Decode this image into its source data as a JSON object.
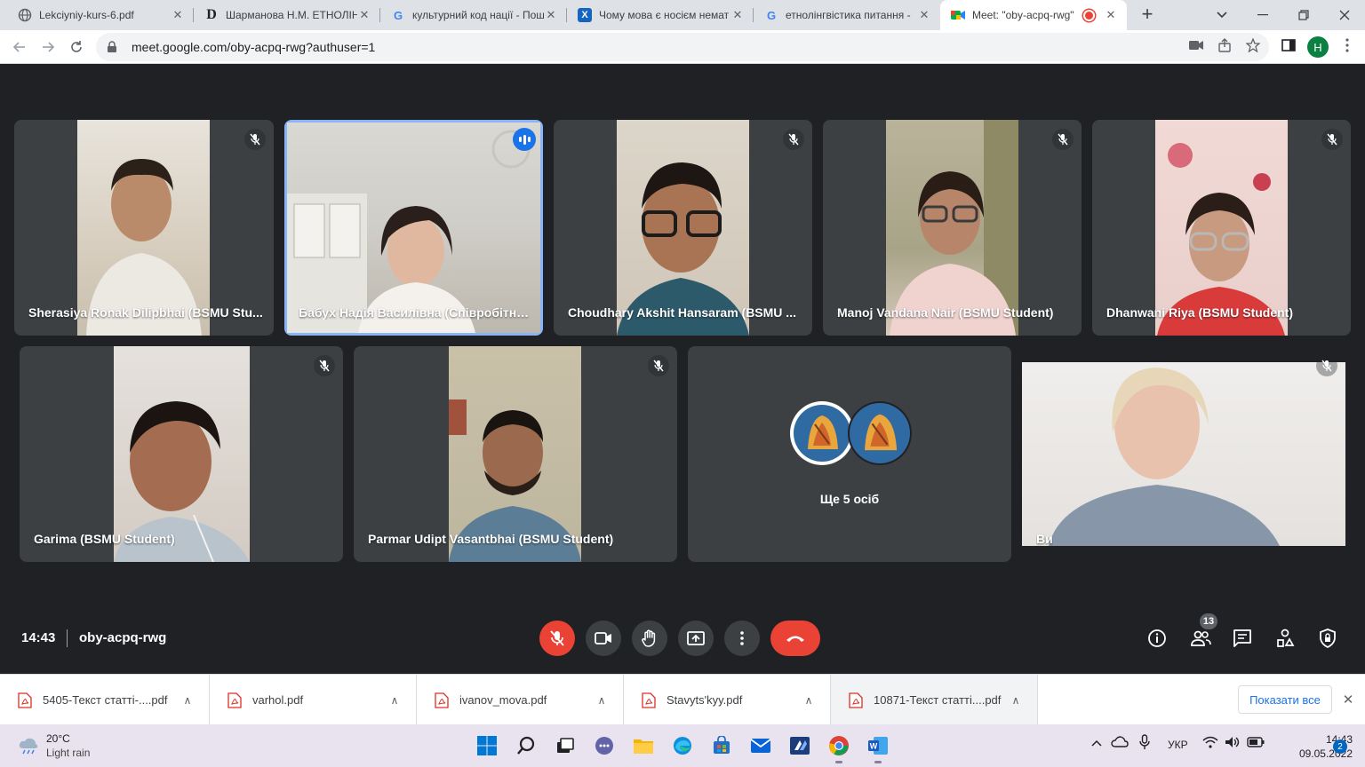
{
  "browser": {
    "tabs": [
      {
        "title": "Lekciyniy-kurs-6.pdf",
        "icon": "globe-icon"
      },
      {
        "title": "Шарманова Н.М. ЕТНОЛІНГ",
        "icon": "d-letter-icon"
      },
      {
        "title": "культурний код нації - Пош",
        "icon": "google-icon"
      },
      {
        "title": "Чому мова є носієм немат",
        "icon": "x-logo-icon"
      },
      {
        "title": "етнолінгвістика питання -",
        "icon": "google-icon"
      },
      {
        "title": "Meet: \"oby-acpq-rwg\"",
        "icon": "meet-icon",
        "active": true,
        "recording": true
      }
    ],
    "url": "meet.google.com/oby-acpq-rwg?authuser=1",
    "profile_initial": "H"
  },
  "meet": {
    "participants_row1": [
      {
        "name": "Sherasiya Ronak Dilipbhai (BSMU Stu...",
        "muted": true
      },
      {
        "name": "Бабух Надія Василівна (Співробітни...",
        "speaking": true
      },
      {
        "name": "Choudhary Akshit Hansaram (BSMU ...",
        "muted": true
      },
      {
        "name": "Manoj Vandana Nair (BSMU Student)",
        "muted": true
      },
      {
        "name": "Dhanwani Riya (BSMU Student)",
        "muted": true
      }
    ],
    "participants_row2": [
      {
        "name": "Garima (BSMU Student)",
        "muted": true
      },
      {
        "name": "Parmar Udipt Vasantbhai (BSMU Student)",
        "muted": true
      }
    ],
    "others_label": "Ще 5 осіб",
    "self_label": "Ви",
    "time": "14:43",
    "meeting_code": "oby-acpq-rwg",
    "participant_count": "13",
    "colors": {
      "accent_blue": "#8ab4f8",
      "mic_off_red": "#ea4335",
      "tile_bg": "#3c4043",
      "stage_bg": "#202124"
    }
  },
  "downloads": {
    "items": [
      {
        "name": "5405-Текст статті-....pdf"
      },
      {
        "name": "varhol.pdf"
      },
      {
        "name": "ivanov_mova.pdf"
      },
      {
        "name": "Stavyts'kyy.pdf"
      },
      {
        "name": "10871-Текст статті....pdf"
      }
    ],
    "show_all": "Показати все"
  },
  "taskbar": {
    "weather_temp": "20°C",
    "weather_desc": "Light rain",
    "language": "УКР",
    "time": "14:43",
    "date": "09.05.2022",
    "notifications": "2"
  }
}
